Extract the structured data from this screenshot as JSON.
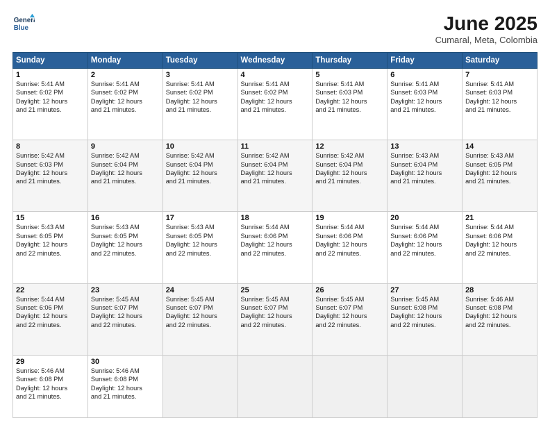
{
  "logo": {
    "line1": "General",
    "line2": "Blue"
  },
  "title": "June 2025",
  "subtitle": "Cumaral, Meta, Colombia",
  "days_header": [
    "Sunday",
    "Monday",
    "Tuesday",
    "Wednesday",
    "Thursday",
    "Friday",
    "Saturday"
  ],
  "weeks": [
    [
      {
        "day": 1,
        "sr": "5:41 AM",
        "ss": "6:02 PM",
        "dl": "12 hours and 21 minutes."
      },
      {
        "day": 2,
        "sr": "5:41 AM",
        "ss": "6:02 PM",
        "dl": "12 hours and 21 minutes."
      },
      {
        "day": 3,
        "sr": "5:41 AM",
        "ss": "6:02 PM",
        "dl": "12 hours and 21 minutes."
      },
      {
        "day": 4,
        "sr": "5:41 AM",
        "ss": "6:02 PM",
        "dl": "12 hours and 21 minutes."
      },
      {
        "day": 5,
        "sr": "5:41 AM",
        "ss": "6:03 PM",
        "dl": "12 hours and 21 minutes."
      },
      {
        "day": 6,
        "sr": "5:41 AM",
        "ss": "6:03 PM",
        "dl": "12 hours and 21 minutes."
      },
      {
        "day": 7,
        "sr": "5:41 AM",
        "ss": "6:03 PM",
        "dl": "12 hours and 21 minutes."
      }
    ],
    [
      {
        "day": 8,
        "sr": "5:42 AM",
        "ss": "6:03 PM",
        "dl": "12 hours and 21 minutes."
      },
      {
        "day": 9,
        "sr": "5:42 AM",
        "ss": "6:04 PM",
        "dl": "12 hours and 21 minutes."
      },
      {
        "day": 10,
        "sr": "5:42 AM",
        "ss": "6:04 PM",
        "dl": "12 hours and 21 minutes."
      },
      {
        "day": 11,
        "sr": "5:42 AM",
        "ss": "6:04 PM",
        "dl": "12 hours and 21 minutes."
      },
      {
        "day": 12,
        "sr": "5:42 AM",
        "ss": "6:04 PM",
        "dl": "12 hours and 21 minutes."
      },
      {
        "day": 13,
        "sr": "5:43 AM",
        "ss": "6:04 PM",
        "dl": "12 hours and 21 minutes."
      },
      {
        "day": 14,
        "sr": "5:43 AM",
        "ss": "6:05 PM",
        "dl": "12 hours and 21 minutes."
      }
    ],
    [
      {
        "day": 15,
        "sr": "5:43 AM",
        "ss": "6:05 PM",
        "dl": "12 hours and 22 minutes."
      },
      {
        "day": 16,
        "sr": "5:43 AM",
        "ss": "6:05 PM",
        "dl": "12 hours and 22 minutes."
      },
      {
        "day": 17,
        "sr": "5:43 AM",
        "ss": "6:05 PM",
        "dl": "12 hours and 22 minutes."
      },
      {
        "day": 18,
        "sr": "5:44 AM",
        "ss": "6:06 PM",
        "dl": "12 hours and 22 minutes."
      },
      {
        "day": 19,
        "sr": "5:44 AM",
        "ss": "6:06 PM",
        "dl": "12 hours and 22 minutes."
      },
      {
        "day": 20,
        "sr": "5:44 AM",
        "ss": "6:06 PM",
        "dl": "12 hours and 22 minutes."
      },
      {
        "day": 21,
        "sr": "5:44 AM",
        "ss": "6:06 PM",
        "dl": "12 hours and 22 minutes."
      }
    ],
    [
      {
        "day": 22,
        "sr": "5:44 AM",
        "ss": "6:06 PM",
        "dl": "12 hours and 22 minutes."
      },
      {
        "day": 23,
        "sr": "5:45 AM",
        "ss": "6:07 PM",
        "dl": "12 hours and 22 minutes."
      },
      {
        "day": 24,
        "sr": "5:45 AM",
        "ss": "6:07 PM",
        "dl": "12 hours and 22 minutes."
      },
      {
        "day": 25,
        "sr": "5:45 AM",
        "ss": "6:07 PM",
        "dl": "12 hours and 22 minutes."
      },
      {
        "day": 26,
        "sr": "5:45 AM",
        "ss": "6:07 PM",
        "dl": "12 hours and 22 minutes."
      },
      {
        "day": 27,
        "sr": "5:45 AM",
        "ss": "6:08 PM",
        "dl": "12 hours and 22 minutes."
      },
      {
        "day": 28,
        "sr": "5:46 AM",
        "ss": "6:08 PM",
        "dl": "12 hours and 22 minutes."
      }
    ],
    [
      {
        "day": 29,
        "sr": "5:46 AM",
        "ss": "6:08 PM",
        "dl": "12 hours and 21 minutes."
      },
      {
        "day": 30,
        "sr": "5:46 AM",
        "ss": "6:08 PM",
        "dl": "12 hours and 21 minutes."
      },
      null,
      null,
      null,
      null,
      null
    ]
  ],
  "labels": {
    "sunrise": "Sunrise:",
    "sunset": "Sunset:",
    "daylight": "Daylight:"
  }
}
